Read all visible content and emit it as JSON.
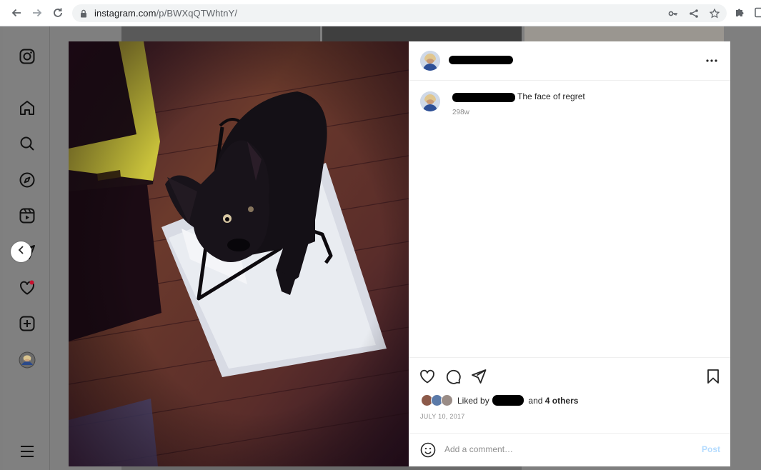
{
  "browser": {
    "url_domain": "instagram.com",
    "url_path": "/p/BWXqQTWhtnY/"
  },
  "post": {
    "caption": "The face of regret",
    "time_ago": "298w",
    "liked_by_prefix": "Liked by",
    "liked_by_and": "and",
    "liked_by_others": "4 others",
    "date": "JULY 10, 2017",
    "comment_placeholder": "Add a comment…",
    "post_label": "Post"
  },
  "colors": {
    "accent_link": "#b3dbff",
    "notification": "#ed4956"
  },
  "icons": {
    "sidebar": [
      "instagram-logo-icon",
      "home-icon",
      "search-icon",
      "explore-icon",
      "reels-icon",
      "messenger-icon",
      "heart-icon",
      "create-icon",
      "profile-avatar",
      "menu-icon"
    ],
    "actions": [
      "like-icon",
      "comment-icon",
      "share-icon",
      "save-icon"
    ]
  }
}
